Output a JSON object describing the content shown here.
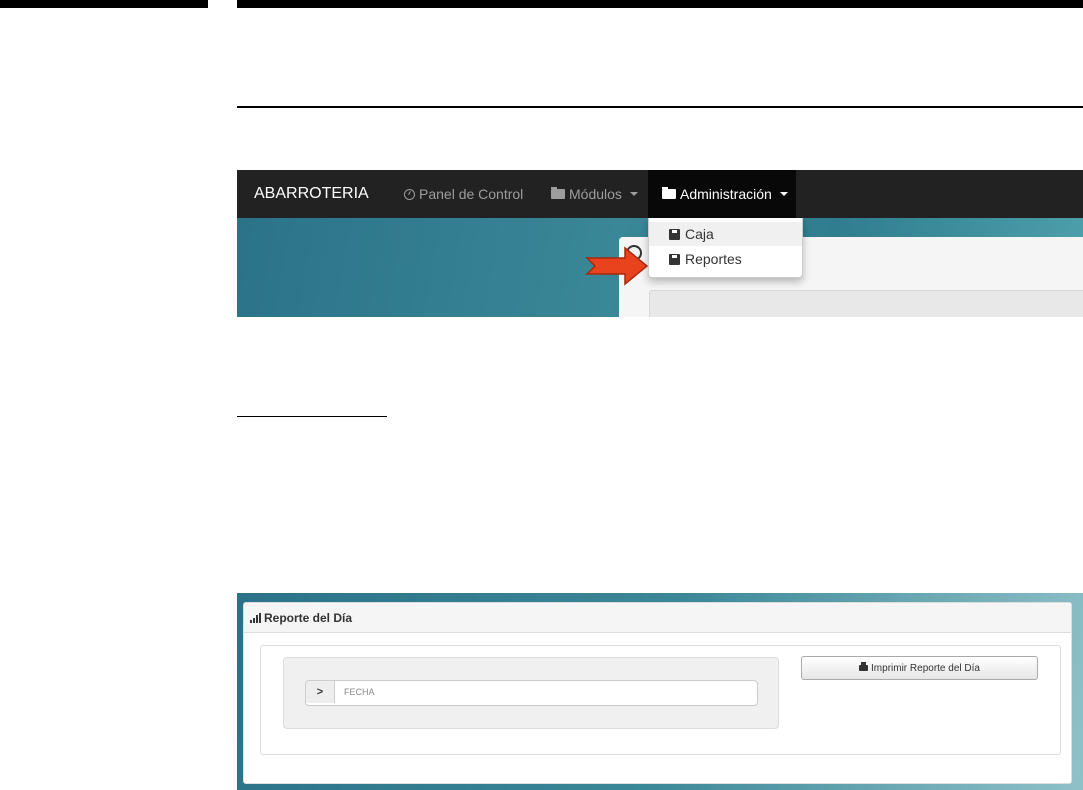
{
  "navbar": {
    "brand": "ABARROTERIA",
    "panel_label": "Panel de Control",
    "modulos_label": "Módulos",
    "admin_label": "Administración"
  },
  "dropdown": {
    "items": [
      {
        "label": "Caja",
        "icon": "floppy-disk-icon"
      },
      {
        "label": "Reportes",
        "icon": "floppy-disk-icon"
      }
    ]
  },
  "report_panel": {
    "title": "Reporte del Día",
    "fecha_placeholder": "FECHA",
    "print_label": "Imprimir Reporte del Día"
  },
  "colors": {
    "navbar": "#222222",
    "pointer_arrow": "#e8431c"
  }
}
